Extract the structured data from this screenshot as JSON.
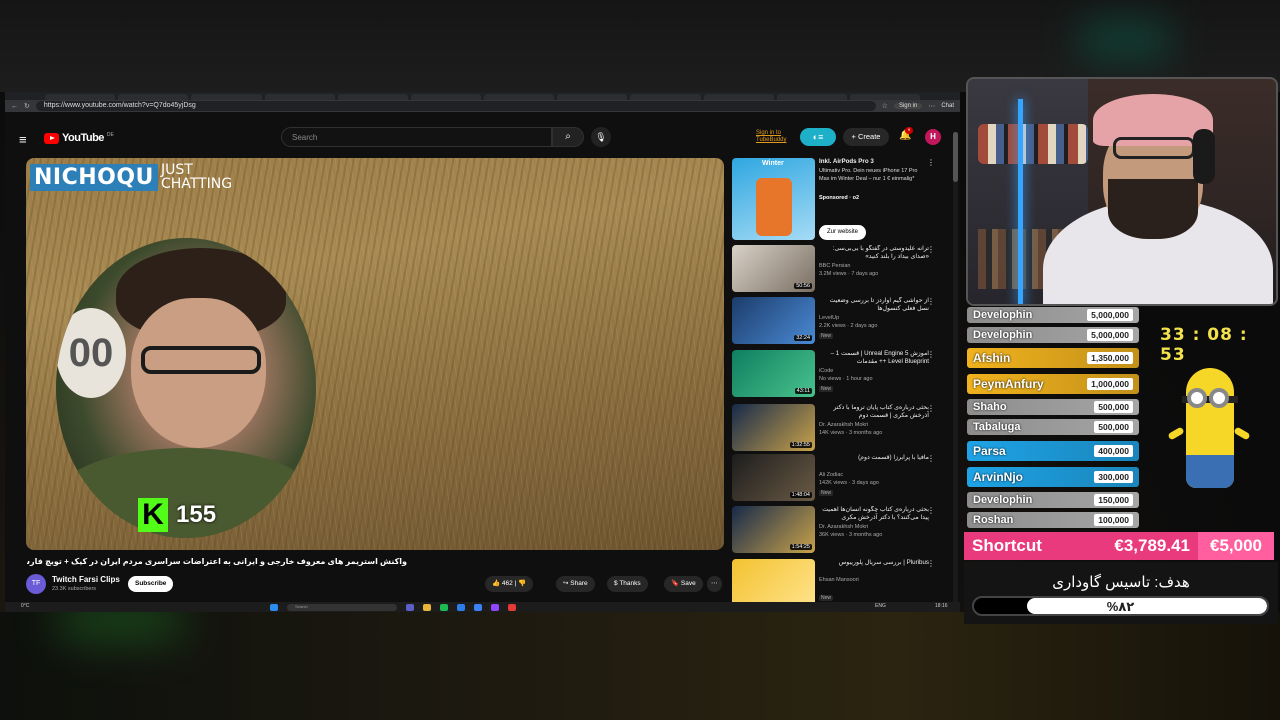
{
  "browser": {
    "tabs": [
      "",
      "",
      "",
      "",
      "",
      "",
      "",
      "",
      "",
      "",
      "",
      ""
    ],
    "url": "https://www.youtube.com/watch?v=Q7do45yjDsg",
    "signin_label": "Sign in",
    "chat_label": "Chat"
  },
  "youtube": {
    "logo_text": "YouTube",
    "logo_region": "DE",
    "search_placeholder": "Search",
    "tubebuddy_text": "Sign in to TubeBuddy",
    "create_label": "Create",
    "notification_count": "9",
    "account_initial": "H"
  },
  "video": {
    "channel_logo_main": "NICHOQU",
    "channel_logo_sub1": "JUST",
    "channel_logo_sub2": "CHATTING",
    "facecam_overlay_digits": "00",
    "kick_viewers": "155",
    "title": "واکنش استریمر های معروف خارجی و ایرانی به اعتراضات سراسری مردم ایران در کیک + تویچ فارسی 768",
    "channel_name": "Twitch Farsi Clips",
    "channel_subs": "23.3K subscribers",
    "subscribe_label": "Subscribe",
    "likes": "462",
    "share_label": "Share",
    "thanks_label": "Thanks",
    "save_label": "Save"
  },
  "sidebar": {
    "ad": {
      "thumb_label": "Winter",
      "title": "Inkl. AirPods Pro 3",
      "desc": "Ultimativ Pro. Dein neues iPhone 17 Pro Max im Winter Deal – nur 1 € einmalig*",
      "sponsored": "Sponsored · o2",
      "button": "Zur website"
    },
    "items": [
      {
        "title": "ترانه علیدوستی در گفتگو با بی‌بی‌سی: «صدای بیداد را بلند کنید»",
        "channel": "BBC Persian",
        "meta": "3.2M views · 7 days ago",
        "duration": "50:56",
        "new": ""
      },
      {
        "title": "از حواشی گیم اواردز تا بررسی وضعیت نسل فعلی کنسول‌ها",
        "channel": "LevelUp",
        "meta": "2.2K views · 2 days ago",
        "duration": "32:24",
        "new": "New",
        "channel2": "NotronX and 2 more"
      },
      {
        "title": "آموزش Unreal Engine 5 | قسمت 1 – Level Blueprint ++ مقدمات",
        "channel": "iCode",
        "meta": "No views · 1 hour ago",
        "duration": "43:11",
        "new": "New"
      },
      {
        "title": "بحثی درباره‌ی کتاب پایان تروما با دکتر آذرخش مکری | قسمت دوم",
        "channel": "Dr. Azarakhsh Mokri",
        "meta": "14K views · 3 months ago",
        "duration": "1:32:55",
        "new": ""
      },
      {
        "title": "مافیا با پرابرزا (قسمت دوم)",
        "channel": "Ali Zodiac",
        "meta": "142K views · 3 days ago",
        "duration": "1:48:04",
        "new": "New"
      },
      {
        "title": "بحثی درباره‌ی کتاب چگونه انسان‌ها اهمیت پیدا می‌کنند؟ با دکتر آذرخش مکری",
        "channel": "Dr. Azarakhsh Mokri",
        "meta": "36K views · 3 months ago",
        "duration": "1:54:25",
        "new": ""
      },
      {
        "title": "Pluribus | بررسی سریال پلوریبوس",
        "channel": "Ehsan Mansoori",
        "meta": "",
        "duration": "",
        "new": "New"
      }
    ]
  },
  "taskbar": {
    "weather": "0°C",
    "search": "Search",
    "lang": "ENG",
    "time": "18:16"
  },
  "overlay": {
    "timer": "33 : 08 : 53",
    "donors": [
      {
        "name": "Develophin",
        "amount": "5,000,000",
        "color": "#9a9a9a"
      },
      {
        "name": "Develophin",
        "amount": "5,000,000",
        "color": "#9a9a9a"
      },
      {
        "name": "Afshin",
        "amount": "1,350,000",
        "color": "#f0b21d"
      },
      {
        "name": "PeymAnfury",
        "amount": "1,000,000",
        "color": "#f0b21d"
      },
      {
        "name": "Shaho",
        "amount": "500,000",
        "color": "#9a9a9a"
      },
      {
        "name": "Tabaluga",
        "amount": "500,000",
        "color": "#9a9a9a"
      },
      {
        "name": "Parsa",
        "amount": "400,000",
        "color": "#1ea3e6"
      },
      {
        "name": "ArvinNjo",
        "amount": "300,000",
        "color": "#1ea3e6"
      },
      {
        "name": "Develophin",
        "amount": "150,000",
        "color": "#9a9a9a"
      },
      {
        "name": "Roshan",
        "amount": "100,000",
        "color": "#9a9a9a"
      }
    ],
    "goal_label": "Shortcut",
    "goal_current": "€3,789.41",
    "goal_target": "€5,000",
    "goal_title": "هدف: تاسیس گاوداری",
    "goal_percent_text": "%۸۲",
    "goal_fraction": 0.82
  },
  "colors": {
    "accent_pink": "#e93a7d",
    "youtube_red": "#ff0000",
    "kick_green": "#53fc18",
    "timer_yellow": "#f3e24b"
  }
}
